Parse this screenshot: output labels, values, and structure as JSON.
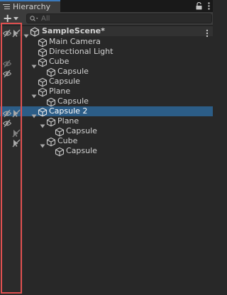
{
  "window": {
    "tab_title": "Hierarchy",
    "accent_color": "#3a79bb",
    "selection_color": "#2c5d87",
    "highlight_color": "#e05050"
  },
  "toolbar": {
    "create_icon": "plus-icon",
    "search_placeholder": "All"
  },
  "tree": {
    "scene": {
      "label": "SampleScene*",
      "icon": "unity-scene-icon"
    },
    "items": [
      {
        "label": "Main Camera",
        "depth": 1,
        "foldout": "none",
        "selected": false,
        "vis": "none",
        "pick": "none"
      },
      {
        "label": "Directional Light",
        "depth": 1,
        "foldout": "none",
        "selected": false,
        "vis": "none",
        "pick": "none"
      },
      {
        "label": "Cube",
        "depth": 1,
        "foldout": "expanded",
        "selected": false,
        "vis": "mixed-hidden",
        "pick": "none"
      },
      {
        "label": "Capsule",
        "depth": 2,
        "foldout": "none",
        "selected": false,
        "vis": "hidden",
        "pick": "none"
      },
      {
        "label": "Capsule",
        "depth": 1,
        "foldout": "none",
        "selected": false,
        "vis": "none",
        "pick": "none"
      },
      {
        "label": "Plane",
        "depth": 1,
        "foldout": "expanded",
        "selected": false,
        "vis": "none",
        "pick": "none"
      },
      {
        "label": "Capsule",
        "depth": 2,
        "foldout": "none",
        "selected": false,
        "vis": "none",
        "pick": "none"
      },
      {
        "label": "Capsule 2",
        "depth": 1,
        "foldout": "expanded",
        "selected": true,
        "vis": "hidden",
        "pick": "disabled"
      },
      {
        "label": "Plane",
        "depth": 2,
        "foldout": "expanded",
        "selected": false,
        "vis": "hidden",
        "pick": "none"
      },
      {
        "label": "Capsule",
        "depth": 3,
        "foldout": "none",
        "selected": false,
        "vis": "none",
        "pick": "mixed-disabled"
      },
      {
        "label": "Cube",
        "depth": 2,
        "foldout": "expanded",
        "selected": false,
        "vis": "none",
        "pick": "disabled"
      },
      {
        "label": "Capsule",
        "depth": 3,
        "foldout": "none",
        "selected": false,
        "vis": "none",
        "pick": "none"
      }
    ],
    "scene_vis": "hidden",
    "scene_pick": "disabled"
  }
}
